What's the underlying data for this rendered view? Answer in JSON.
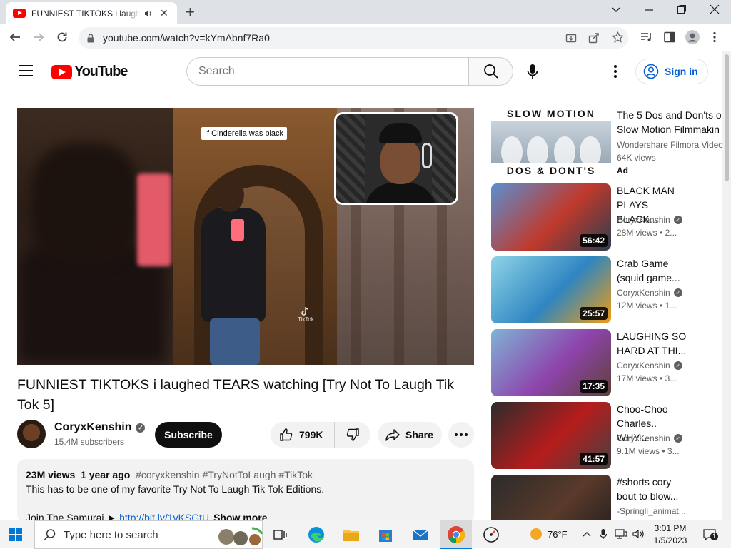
{
  "browser": {
    "tab_title": "FUNNIEST TIKTOKS i laughed TEARS watching [Try Not To Laugh Tik Tok 5]",
    "url": "youtube.com/watch?v=kYmAbnf7Ra0",
    "new_tab_label": "+"
  },
  "masthead": {
    "logo_text": "YouTube",
    "search_placeholder": "Search",
    "signin_label": "Sign in"
  },
  "player": {
    "caption": "If Cinderella was black",
    "watermark": "TikTok"
  },
  "video": {
    "title": "FUNNIEST TIKTOKS i laughed TEARS watching [Try Not To Laugh Tik Tok 5]",
    "channel": "CoryxKenshin",
    "subscribers": "15.4M subscribers",
    "subscribe_label": "Subscribe",
    "likes": "799K",
    "share_label": "Share"
  },
  "description": {
    "views": "23M views",
    "age": "1 year ago",
    "tags": "#coryxkenshin #TryNotToLaugh #TikTok",
    "line1": "This has to be one of my favorite Try Not To Laugh Tik Tok Editions.",
    "join_text": "Join The Samurai ► ",
    "join_link": "http://bit.ly/1vKSGtU",
    "show_more": "Show more"
  },
  "ad": {
    "thumb_top": "SLOW MOTION",
    "thumb_bottom": "DOS & DONT'S",
    "title_line1": "The 5 Dos and Don'ts o",
    "title_line2": "Slow Motion Filmmakin",
    "channel": "Wondershare Filmora Video",
    "views": "64K views",
    "badge": "Ad"
  },
  "recommendations": [
    {
      "title": "BLACK MAN PLAYS BLACK...",
      "channel": "CoryxKenshin",
      "verified": true,
      "views": "28M views",
      "age": "2...",
      "duration": "56:42",
      "thumb_colors": [
        "#5a8fd0",
        "#c0392b",
        "#2c3e50"
      ]
    },
    {
      "title": "Crab Game (squid game...",
      "channel": "CoryxKenshin",
      "verified": true,
      "views": "12M views",
      "age": "1...",
      "duration": "25:57",
      "thumb_colors": [
        "#8fd3e8",
        "#2e86c1",
        "#f39c12"
      ]
    },
    {
      "title": "LAUGHING SO HARD AT THI...",
      "channel": "CoryxKenshin",
      "verified": true,
      "views": "17M views",
      "age": "3...",
      "duration": "17:35",
      "thumb_colors": [
        "#7fb3d5",
        "#8e44ad",
        "#5d4037"
      ]
    },
    {
      "title": "Choo-Choo Charles.. WHY...",
      "channel": "CoryxKenshin",
      "verified": true,
      "views": "9.1M views",
      "age": "3...",
      "duration": "41:57",
      "thumb_colors": [
        "#2c2c2c",
        "#b71c1c",
        "#424242"
      ]
    },
    {
      "title": "#shorts cory bout to blow...",
      "channel": "-Springli_animat...",
      "verified": false,
      "views": "",
      "age": "",
      "duration": "",
      "thumb_colors": [
        "#2b2b2b",
        "#5a3a2a",
        "#1e1e1e"
      ]
    }
  ],
  "taskbar": {
    "search_placeholder": "Type here to search",
    "temperature": "76°F",
    "time": "3:01 PM",
    "date": "1/5/2023",
    "notification_count": "1"
  },
  "colors": {
    "youtube_red": "#ff0000",
    "link_blue": "#065fd4",
    "subscribe_black": "#0f0f0f"
  }
}
